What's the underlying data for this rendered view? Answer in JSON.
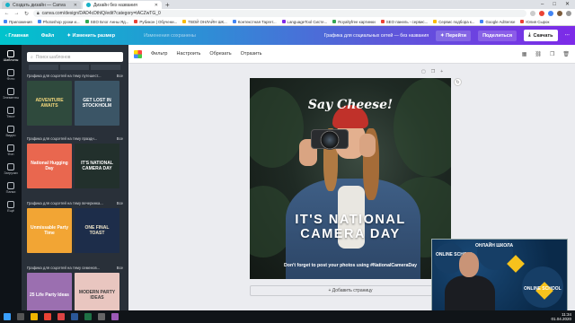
{
  "browser": {
    "tabs": [
      {
        "title": "Создать дизайн — Canva",
        "active": false
      },
      {
        "title": "Дизайн без названия",
        "active": true
      }
    ],
    "new_tab": "+",
    "window_controls": [
      "–",
      "□",
      "✕"
    ],
    "url": "canva.com/design/DAD4cDthlQ/edit?category=tACZwTG_0",
    "bookmarks": [
      {
        "label": "Приложения",
        "color": "b"
      },
      {
        "label": "Photoshop уроки и...",
        "color": "b"
      },
      {
        "label": "SEO Блог Анны Яд...",
        "color": "g"
      },
      {
        "label": "Рубикон | Обучени...",
        "color": "r"
      },
      {
        "label": "ТВОЙ ОНЛАЙН ШК...",
        "color": "y"
      },
      {
        "label": "Контекстная Таргет...",
        "color": "b"
      },
      {
        "label": "LanguageTool Систе...",
        "color": "p"
      },
      {
        "label": "Royaltyfree картинки",
        "color": "g"
      },
      {
        "label": "SEO панель - сервис...",
        "color": "r"
      },
      {
        "label": "Сервис подбора к...",
        "color": "y"
      },
      {
        "label": "Google AdSense",
        "color": "b"
      },
      {
        "label": "Юлия Сырок",
        "color": "r"
      }
    ]
  },
  "canva_header": {
    "home": "‹  Главная",
    "file": "Файл",
    "resize": "✦ Изменить размер",
    "saved": "Изменения сохранены",
    "title": "Графика для социальных сетей — без названия",
    "go_button": "✦ Перейти",
    "share_button": "Поделиться",
    "download_button": "Скачать"
  },
  "rail": [
    {
      "label": "Шаблоны",
      "active": true
    },
    {
      "label": "Фото",
      "active": false
    },
    {
      "label": "Элементы",
      "active": false
    },
    {
      "label": "Текст",
      "active": false
    },
    {
      "label": "Видео",
      "active": false
    },
    {
      "label": "Фон",
      "active": false
    },
    {
      "label": "Загрузки",
      "active": false
    },
    {
      "label": "Папки",
      "active": false
    },
    {
      "label": "Ещё",
      "active": false
    }
  ],
  "templates_panel": {
    "search_placeholder": "Поиск шаблонов",
    "sections": [
      {
        "title": "Графика для соцсетей на тему путешест...",
        "all": "Все",
        "thumbs": [
          {
            "text": "ADVENTURE AWAITS",
            "bg": "#2f4a3d",
            "fg": "#f3d77b"
          },
          {
            "text": "GET LOST IN STOCKHOLM",
            "bg": "#3b5566",
            "fg": "#ffffff"
          }
        ]
      },
      {
        "title": "Графика для соцсетей на тему праздн...",
        "all": "Все",
        "thumbs": [
          {
            "text": "National Hugging Day",
            "bg": "#e9674f",
            "fg": "#ffffff"
          },
          {
            "text": "IT'S NATIONAL CAMERA DAY",
            "bg": "#22302c",
            "fg": "#ffffff"
          }
        ]
      },
      {
        "title": "Графика для соцсетей на тему вечеринка...",
        "all": "Все",
        "thumbs": [
          {
            "text": "Unmissable Party Time",
            "bg": "#f2a534",
            "fg": "#ffffff"
          },
          {
            "text": "ONE FINAL TOAST",
            "bg": "#1d2d4a",
            "fg": "#f1e6c9"
          }
        ]
      },
      {
        "title": "Графика для соцсетей на тему семенов...",
        "all": "Все",
        "thumbs": [
          {
            "text": "25 Life Party Ideas",
            "bg": "#9b6fb0",
            "fg": "#ffffff"
          },
          {
            "text": "MODERN PARTY IDEAS",
            "bg": "#e9c6c0",
            "fg": "#3b3b3b"
          }
        ]
      }
    ]
  },
  "toolbar": {
    "filter": "Фильтр",
    "adjust": "Настроить",
    "crop": "Обрезать",
    "flip": "Отразить"
  },
  "design": {
    "top_text": "Say Cheese!",
    "headline_1": "IT'S NATIONAL",
    "headline_2": "CAMERA DAY",
    "subtext": "Don't forget to post your photos using #NationalCameraDay"
  },
  "add_page": "+ Добавить страницу",
  "webcam": {
    "label_1": "ОНЛАЙН ШКОЛА",
    "label_2": "ONLINE SCHOOL",
    "label_3": "ONLINE SCHOOL"
  },
  "taskbar": {
    "time": "11:34",
    "date": "01.04.2020"
  },
  "colors": {
    "canva_gradient_start": "#00c4cc",
    "canva_gradient_end": "#7d2ae8",
    "panel_bg": "#293039",
    "rail_bg": "#0e1318"
  }
}
